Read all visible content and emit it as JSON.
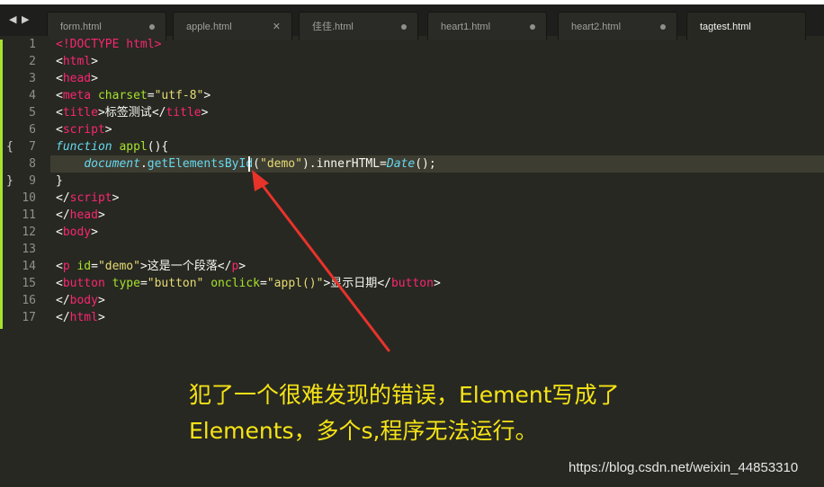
{
  "editor": {
    "tabs": [
      {
        "label": "form.html",
        "state": "modified"
      },
      {
        "label": "apple.html",
        "state": "close"
      },
      {
        "label": "佳佳.html",
        "state": "modified"
      },
      {
        "label": "heart1.html",
        "state": "modified"
      },
      {
        "label": "heart2.html",
        "state": "modified"
      },
      {
        "label": "tagtest.html",
        "state": "active"
      }
    ],
    "nav": {
      "back": "◀",
      "forward": "▶"
    },
    "close_glyph": "✕",
    "line_numbers": [
      "1",
      "2",
      "3",
      "4",
      "5",
      "6",
      "7",
      "8",
      "9",
      "10",
      "11",
      "12",
      "13",
      "14",
      "15",
      "16",
      "17"
    ],
    "fold_open": "{",
    "fold_close": "}",
    "code": {
      "l1": "<!DOCTYPE html>",
      "l2_open": "<",
      "l2_tag": "html",
      "l2_close": ">",
      "l3_open": "<",
      "l3_tag": "head",
      "l3_close": ">",
      "l4_open": "<",
      "l4_tag": "meta",
      "l4_attr": "charset",
      "l4_eq": "=",
      "l4_val": "\"utf-8\"",
      "l4_close": ">",
      "l5_open": "<",
      "l5_tag": "title",
      "l5_close": ">",
      "l5_text": "标签测试",
      "l5_end_open": "</",
      "l5_end_tag": "title",
      "l5_end_close": ">",
      "l6_open": "<",
      "l6_tag": "script",
      "l6_close": ">",
      "l7_kw": "function",
      "l7_name": "appl",
      "l7_rest": "(){",
      "l8_indent": "    ",
      "l8_obj": "document",
      "l8_dot": ".",
      "l8_method": "getElementsById",
      "l8_paren1": "(",
      "l8_arg": "\"demo\"",
      "l8_after": ").innerHTML=",
      "l8_date": "Date",
      "l8_end": "();",
      "l9": "}",
      "l10_open": "</",
      "l10_tag": "script",
      "l10_close": ">",
      "l11_open": "</",
      "l11_tag": "head",
      "l11_close": ">",
      "l12_open": "<",
      "l12_tag": "body",
      "l12_close": ">",
      "l14_open": "<",
      "l14_tag": "p",
      "l14_attr": " id",
      "l14_eq": "=",
      "l14_val": "\"demo\"",
      "l14_close": ">",
      "l14_text": "这是一个段落",
      "l14_end_open": "</",
      "l14_end_tag": "p",
      "l14_end_close": ">",
      "l15_open": "<",
      "l15_tag": "button",
      "l15_attr1": " type",
      "l15_eq1": "=",
      "l15_val1": "\"button\"",
      "l15_attr2": " onclick",
      "l15_eq2": "=",
      "l15_val2": "\"appl()\"",
      "l15_close": ">",
      "l15_text": "显示日期",
      "l15_end_open": "</",
      "l15_end_tag": "button",
      "l15_end_close": ">",
      "l16_open": "</",
      "l16_tag": "body",
      "l16_close": ">",
      "l17_open": "</",
      "l17_tag": "html",
      "l17_close": ">"
    }
  },
  "annotation": {
    "line1": "犯了一个很难发现的错误，Element写成了",
    "line2": "Elements，多个s,程序无法运行。"
  },
  "watermark": "https://blog.csdn.net/weixin_44853310",
  "colors": {
    "background": "#272822",
    "annotation": "#f5e316",
    "arrow": "#e8332b",
    "tag": "#f92672",
    "string": "#e6db74",
    "attr": "#a6e22e",
    "keyword": "#66d9ef"
  }
}
